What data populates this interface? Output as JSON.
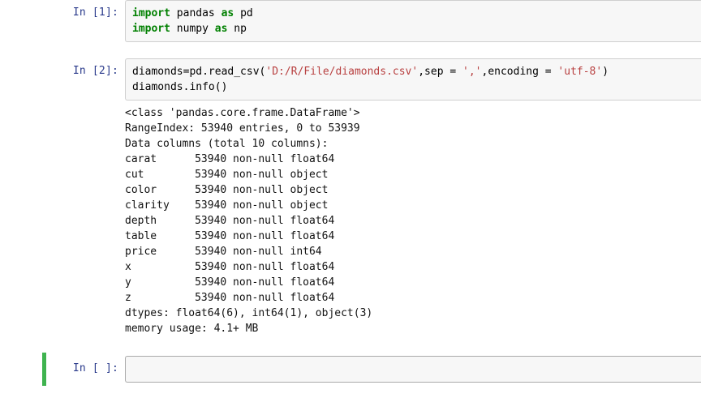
{
  "cells": {
    "c1": {
      "prompt": "In  [1]:",
      "code_tokens": [
        {
          "cls": "tok-kw",
          "t": "import"
        },
        {
          "cls": "",
          "t": " pandas "
        },
        {
          "cls": "tok-kw",
          "t": "as"
        },
        {
          "cls": "",
          "t": " pd\n"
        },
        {
          "cls": "tok-kw",
          "t": "import"
        },
        {
          "cls": "",
          "t": " numpy "
        },
        {
          "cls": "tok-kw",
          "t": "as"
        },
        {
          "cls": "",
          "t": " np"
        }
      ]
    },
    "c2": {
      "prompt": "In  [2]:",
      "code_tokens": [
        {
          "cls": "",
          "t": "diamonds=pd.read_csv("
        },
        {
          "cls": "tok-str",
          "t": "'D:/R/File/diamonds.csv'"
        },
        {
          "cls": "",
          "t": ",sep = "
        },
        {
          "cls": "tok-str",
          "t": "','"
        },
        {
          "cls": "",
          "t": ",encoding = "
        },
        {
          "cls": "tok-str",
          "t": "'utf-8'"
        },
        {
          "cls": "",
          "t": ")\ndiamonds.info()"
        }
      ],
      "output": "<class 'pandas.core.frame.DataFrame'>\nRangeIndex: 53940 entries, 0 to 53939\nData columns (total 10 columns):\ncarat      53940 non-null float64\ncut        53940 non-null object\ncolor      53940 non-null object\nclarity    53940 non-null object\ndepth      53940 non-null float64\ntable      53940 non-null float64\nprice      53940 non-null int64\nx          53940 non-null float64\ny          53940 non-null float64\nz          53940 non-null float64\ndtypes: float64(6), int64(1), object(3)\nmemory usage: 4.1+ MB"
    },
    "c3": {
      "prompt": "In  [ ]:",
      "code_tokens": [
        {
          "cls": "",
          "t": " "
        }
      ]
    }
  }
}
